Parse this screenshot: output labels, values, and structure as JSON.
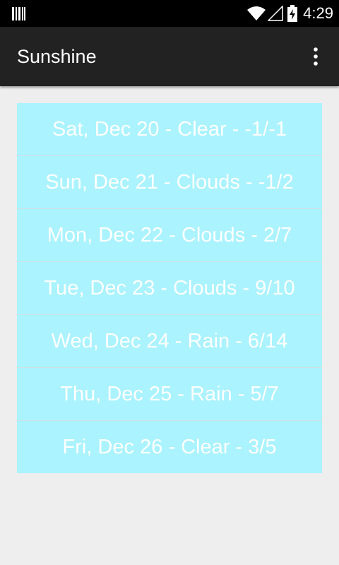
{
  "status_bar": {
    "time": "4:29",
    "left_icon": "barcode-icon",
    "icons": [
      "wifi-icon",
      "signal-icon",
      "battery-charging-icon"
    ]
  },
  "action_bar": {
    "title": "Sunshine",
    "overflow_icon": "overflow-menu-icon"
  },
  "forecast": {
    "items": [
      "Sat, Dec 20 - Clear - -1/-1",
      "Sun, Dec 21 - Clouds - -1/2",
      "Mon, Dec 22 - Clouds - 2/7",
      "Tue, Dec 23 - Clouds - 9/10",
      "Wed, Dec 24 - Rain - 6/14",
      "Thu, Dec 25 - Rain - 5/7",
      "Fri, Dec 26 - Clear - 3/5"
    ]
  },
  "colors": {
    "status_bar_bg": "#000000",
    "action_bar_bg": "#222222",
    "list_bg": "#aaf3ff",
    "page_bg": "#eeeeee",
    "text": "#ffffff"
  }
}
